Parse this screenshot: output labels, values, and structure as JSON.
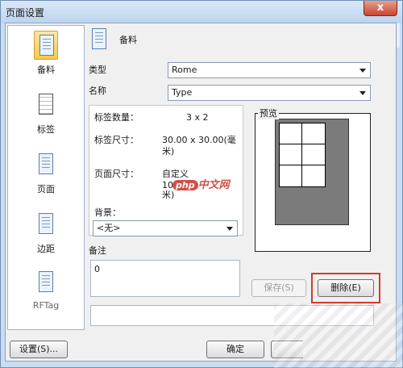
{
  "window": {
    "title": "页面设置",
    "close_label": "x"
  },
  "sidebar": {
    "items": [
      {
        "label": "备料",
        "icon": "document-stack-icon",
        "selected": true
      },
      {
        "label": "标签",
        "icon": "label-grid-icon",
        "selected": false
      },
      {
        "label": "页面",
        "icon": "page-document-icon",
        "selected": false
      },
      {
        "label": "边距",
        "icon": "margin-documents-icon",
        "selected": false
      },
      {
        "label": "RFTag",
        "icon": "rftag-document-icon",
        "selected": false
      }
    ]
  },
  "section": {
    "title": "备料",
    "icon": "document-stack-icon"
  },
  "form": {
    "type_label": "类型",
    "type_value": "Rome",
    "name_label": "名称",
    "name_value": "Type"
  },
  "info": {
    "label_count_label": "标签数量：",
    "label_count_value": "3 x 2",
    "label_size_label": "标签尺寸：",
    "label_size_value_1": "30.00 x 30.00(毫",
    "label_size_value_2": "米)",
    "page_size_label": "页面尺寸：",
    "page_size_value_1": "自定义",
    "page_size_value_2": "10",
    "page_size_value_3": "米)",
    "background_label": "背景：",
    "background_value": "<无>"
  },
  "preview": {
    "label": "预览",
    "columns": 2,
    "rows": 3
  },
  "memo": {
    "label": "备注",
    "value": "0"
  },
  "buttons": {
    "save": "保存(S)",
    "delete": "删除(E)",
    "settings": "设置(S)...",
    "ok": "确定"
  },
  "watermark": {
    "tag": "php",
    "text": "中文网"
  },
  "colors": {
    "highlight": "#d23c2a",
    "selected_bg": "#f7c94e",
    "preview_page": "#7b7b7b"
  }
}
